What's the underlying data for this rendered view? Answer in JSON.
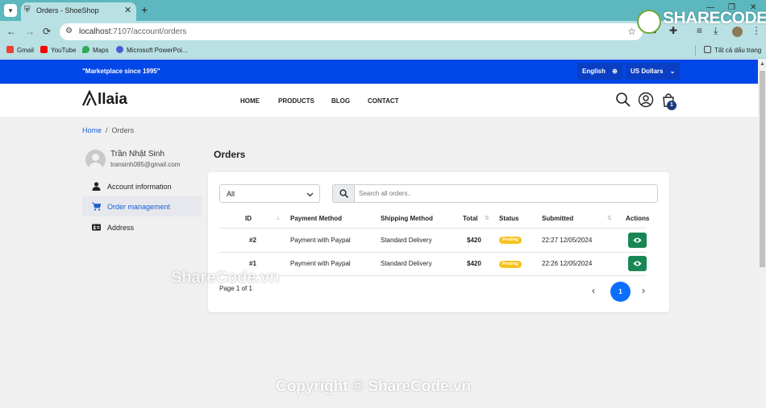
{
  "browser": {
    "tab_title": "Orders - ShoeShop",
    "url_host": "localhost",
    "url_rest": ":7107/account/orders",
    "bookmarks": [
      "Gmail",
      "YouTube",
      "Maps",
      "Microsoft PowerPoi...",
      "Tất cả dấu trang"
    ]
  },
  "watermarks": {
    "logo": "SHARECODE.vn",
    "mid": "ShareCode.vn",
    "bottom": "Copyright © ShareCode.vn"
  },
  "topbar": {
    "tagline": "\"Marketplace since 1995\"",
    "language": "English",
    "currency": "US Dollars"
  },
  "header": {
    "brand": "llaia",
    "nav": [
      "HOME",
      "PRODUCTS",
      "BLOG",
      "CONTACT"
    ],
    "cart_count": "1"
  },
  "breadcrumb": {
    "home": "Home",
    "separator": "/",
    "current": "Orders"
  },
  "sidebar": {
    "user_name": "Trần Nhật Sinh",
    "user_email": "transinh085@gmail.com",
    "items": [
      {
        "label": "Account information",
        "icon": "user-icon"
      },
      {
        "label": "Order management",
        "icon": "cart-icon",
        "active": true
      },
      {
        "label": "Address",
        "icon": "address-card-icon"
      }
    ]
  },
  "orders": {
    "title": "Orders",
    "filter_value": "All",
    "search_placeholder": "Search all orders..",
    "columns": [
      "ID",
      "Payment Method",
      "Shipping Method",
      "Total",
      "Status",
      "Submitted",
      "Actions"
    ],
    "rows": [
      {
        "id": "#2",
        "payment": "Payment with Paypal",
        "shipping": "Standard Delivery",
        "total": "$420",
        "status": "Pending",
        "submitted": "22:27 12/05/2024"
      },
      {
        "id": "#1",
        "payment": "Payment with Paypal",
        "shipping": "Standard Delivery",
        "total": "$420",
        "status": "Pending",
        "submitted": "22:26 12/05/2024"
      }
    ],
    "page_info": "Page 1 of 1",
    "current_page": "1"
  },
  "colors": {
    "topbar": "#0147e8",
    "accent": "#0b6efd",
    "status_pending": "#f6c21b",
    "view_button": "#198754"
  }
}
